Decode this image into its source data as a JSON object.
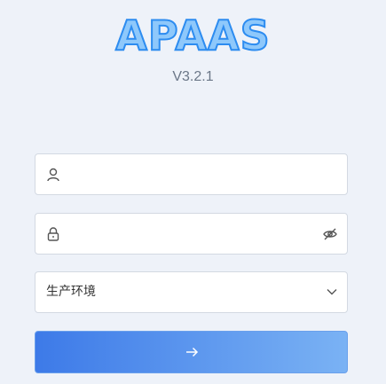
{
  "brand": {
    "logo_text": "APAAS",
    "version": "V3.2.1"
  },
  "form": {
    "username": {
      "value": "",
      "placeholder": "",
      "icon": "user-icon"
    },
    "password": {
      "value": "",
      "placeholder": "",
      "icon": "lock-icon",
      "toggle_icon": "eye-off-icon"
    },
    "environment": {
      "selected": "生产环境",
      "icon": "chevron-down-icon"
    },
    "submit": {
      "icon": "arrow-right-icon"
    }
  },
  "colors": {
    "background": "#eef2f9",
    "logo_fill": "#8ec8fb",
    "logo_stroke": "#2d8cf0",
    "button_gradient_start": "#3d7ae8",
    "button_gradient_end": "#7ab2f4"
  }
}
